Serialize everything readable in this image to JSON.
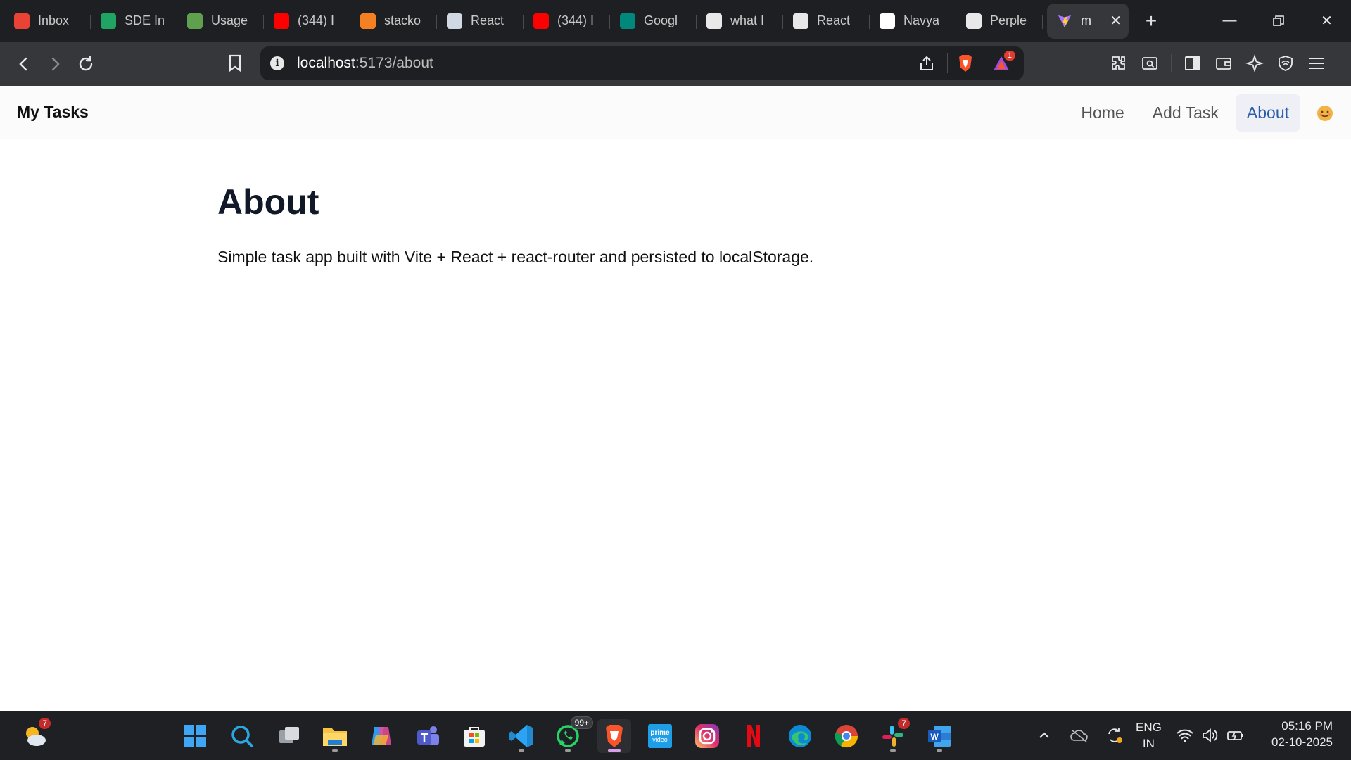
{
  "browser": {
    "tabs": [
      {
        "label": "Inbox",
        "icon": "gmail-icon",
        "color": "#ea4335"
      },
      {
        "label": "SDE In",
        "icon": "sheets-icon",
        "color": "#1fa463"
      },
      {
        "label": "Usage",
        "icon": "node-icon",
        "color": "#5fa04e"
      },
      {
        "label": "(344) I",
        "icon": "youtube-icon",
        "color": "#ff0000"
      },
      {
        "label": "stacko",
        "icon": "stackoverflow-icon",
        "color": "#f48024"
      },
      {
        "label": "React",
        "icon": "document-icon",
        "color": "#cfd8e3"
      },
      {
        "label": "(344) I",
        "icon": "youtube-icon",
        "color": "#ff0000"
      },
      {
        "label": "Googl",
        "icon": "google-meet-icon",
        "color": "#00897b"
      },
      {
        "label": "what I",
        "icon": "brave-search-icon",
        "color": "#e8e8e8"
      },
      {
        "label": "React",
        "icon": "chatgpt-icon",
        "color": "#e8e8e8"
      },
      {
        "label": "Navya",
        "icon": "github-icon",
        "color": "#ffffff"
      },
      {
        "label": "Perple",
        "icon": "perplexity-icon",
        "color": "#e8e8e8"
      }
    ],
    "active_tab": {
      "label": "m",
      "icon": "vite-icon"
    },
    "new_tab_label": "+",
    "url_host": "localhost",
    "url_rest": ":5173/about",
    "shields_badge": "1"
  },
  "app": {
    "brand": "My Tasks",
    "nav": {
      "home": "Home",
      "add_task": "Add Task",
      "about": "About"
    },
    "heading": "About",
    "description": "Simple task app built with Vite + React + react-router and persisted to localStorage."
  },
  "taskbar": {
    "weather_badge": "7",
    "whatsapp_badge": "99+",
    "slack_badge": "7",
    "language": "ENG",
    "region": "IN",
    "time": "05:16 PM",
    "date": "02-10-2025"
  }
}
